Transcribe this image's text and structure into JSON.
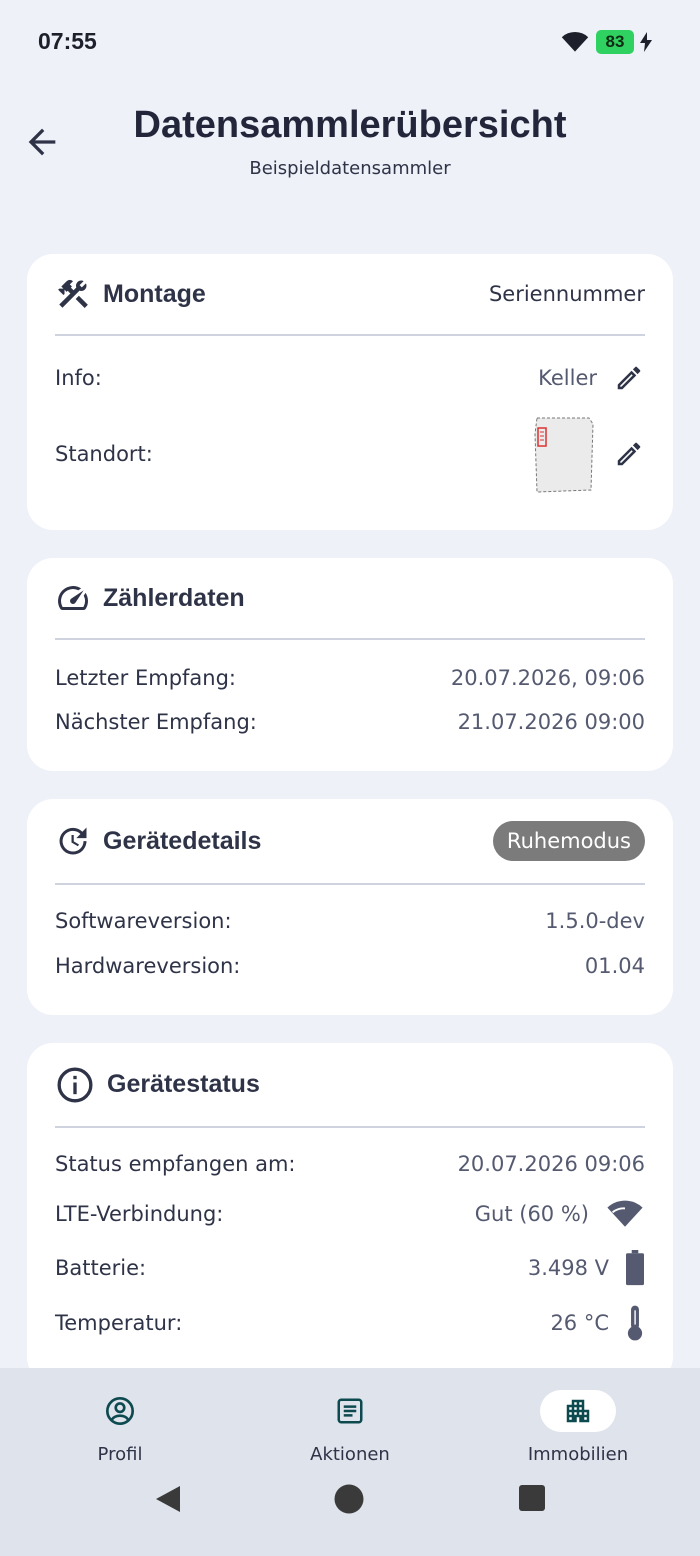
{
  "status_bar": {
    "time": "07:55",
    "battery": "83"
  },
  "header": {
    "title": "Datensammlerübersicht",
    "subtitle": "Beispieldatensammler"
  },
  "montage": {
    "title": "Montage",
    "right_label": "Seriennummer",
    "rows": [
      {
        "label": "Info:",
        "value": "Keller"
      },
      {
        "label": "Standort:",
        "value": ""
      }
    ]
  },
  "zaehlerdaten": {
    "title": "Zählerdaten",
    "rows": [
      {
        "label": "Letzter Empfang:",
        "value": "20.07.2026, 09:06"
      },
      {
        "label": "Nächster Empfang:",
        "value": "21.07.2026 09:00"
      }
    ]
  },
  "geraetedetails": {
    "title": "Gerätedetails",
    "badge": "Ruhemodus",
    "rows": [
      {
        "label": "Softwareversion:",
        "value": "1.5.0-dev"
      },
      {
        "label": "Hardwareversion:",
        "value": "01.04"
      }
    ]
  },
  "geraetestatus": {
    "title": "Gerätestatus",
    "rows": [
      {
        "label": "Status empfangen am:",
        "value": "20.07.2026 09:06"
      },
      {
        "label": "LTE-Verbindung:",
        "value": "Gut (60 %)"
      },
      {
        "label": "Batterie:",
        "value": "3.498 V"
      },
      {
        "label": "Temperatur:",
        "value": "26 °C"
      }
    ]
  },
  "bottom_nav": {
    "items": [
      {
        "label": "Profil",
        "icon": "account-circle-icon"
      },
      {
        "label": "Aktionen",
        "icon": "article-icon"
      },
      {
        "label": "Immobilien",
        "icon": "apartment-icon",
        "active": true
      }
    ]
  },
  "colors": {
    "background": "#eef1f8",
    "card": "#ffffff",
    "accent": "#0d4a4f",
    "badge": "#7b7b7b",
    "battery": "#2fd160"
  }
}
